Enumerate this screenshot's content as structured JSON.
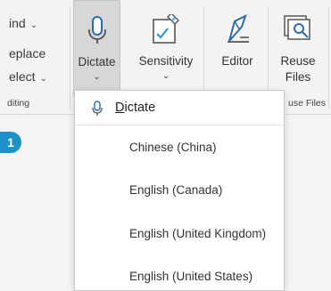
{
  "editing": {
    "find": "ind",
    "replace": "eplace",
    "select": "elect",
    "group_label": "diting"
  },
  "ribbon": {
    "dictate_label": "Dictate",
    "sensitivity_label": "Sensitivity",
    "editor_label": "Editor",
    "reuse_line1": "Reuse",
    "reuse_line2": "Files",
    "reuse_group_label": "use Files",
    "chevron": "⌄"
  },
  "dictate_menu": {
    "header_first_letter": "D",
    "header_rest": "ictate",
    "languages": [
      "Chinese (China)",
      "English (Canada)",
      "English (United Kingdom)",
      "English (United States)"
    ]
  },
  "callout": {
    "number": "1"
  },
  "colors": {
    "accent": "#1e91c9",
    "icon_blue": "#2b6cb0",
    "dictate_selected_bg": "#d7d7d7"
  },
  "icons": [
    "microphone-icon",
    "sensitivity-icon",
    "editor-pen-icon",
    "reuse-files-icon"
  ]
}
